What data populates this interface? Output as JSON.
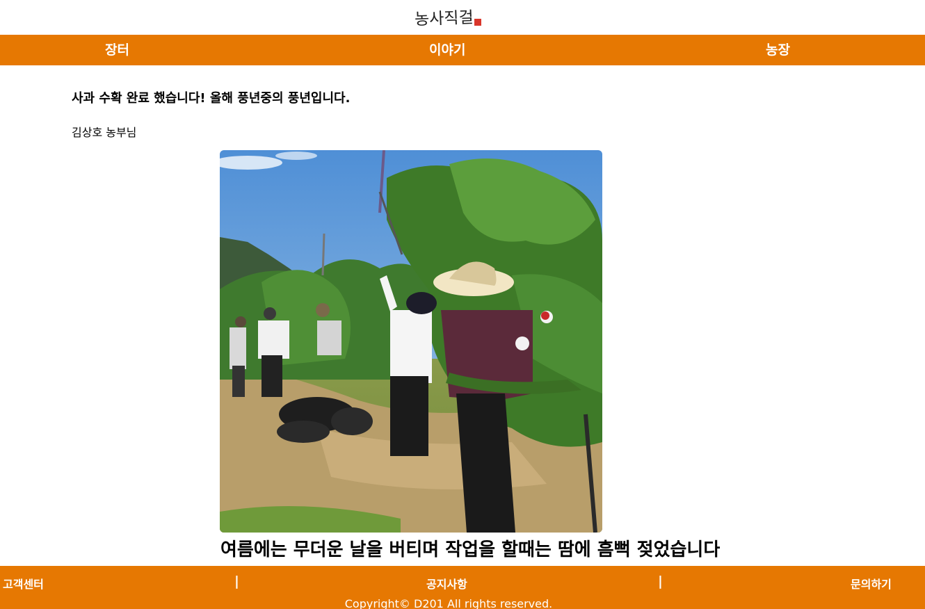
{
  "header": {
    "logo_text": "농사직걸"
  },
  "nav": {
    "items": [
      "장터",
      "이야기",
      "농장"
    ]
  },
  "post": {
    "title": "사과 수확 완료 했습니다! 올해 풍년중의 풍년입니다.",
    "author": "김상호 농부님",
    "caption": "여름에는 무더운 날을 버티며 작업을 할때는 땀에 흠뻑 젖었습니다"
  },
  "footer": {
    "links": [
      "고객센터",
      "공지사항",
      "문의하기"
    ],
    "separator": "|",
    "copyright": "Copyright© D201 All rights reserved."
  },
  "colors": {
    "accent": "#e67802",
    "text": "#000000",
    "background": "#ffffff"
  }
}
